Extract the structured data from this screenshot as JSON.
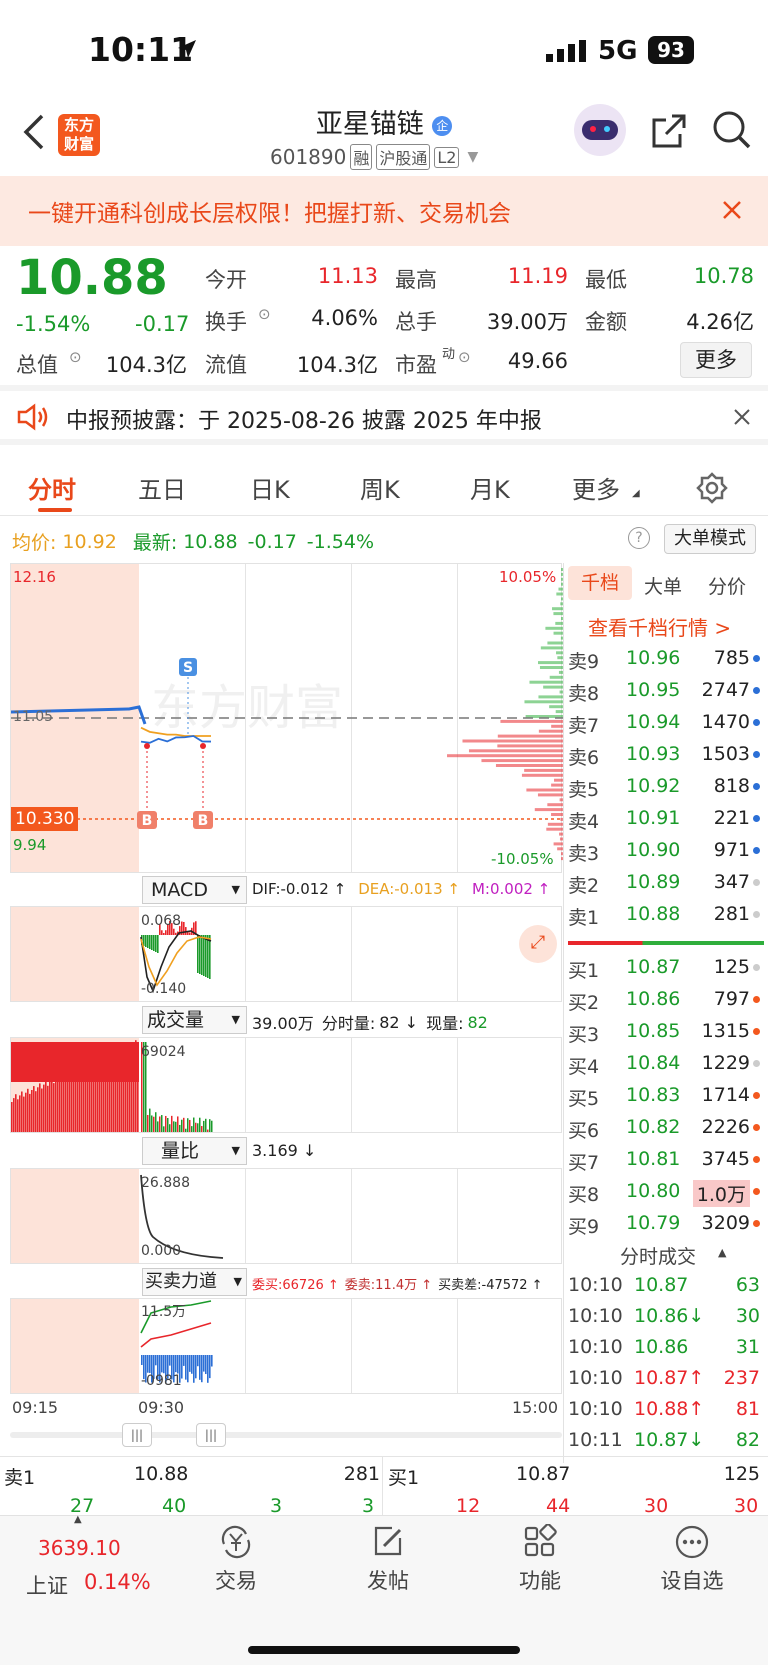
{
  "status_bar": {
    "time": "10:11",
    "network": "5G",
    "battery": "93"
  },
  "header": {
    "back_icon": "chevron-left-icon",
    "logo": "东方\n财富",
    "stock_name": "亚星锚链",
    "qualified_badge": "企",
    "code": "601890",
    "tags": [
      "融",
      "沪股通",
      "L2"
    ],
    "share_icon": "share-icon",
    "search_icon": "search-icon"
  },
  "banner": {
    "text": "一键开通科创成长层权限！把握打新、交易机会"
  },
  "quote": {
    "price": "10.88",
    "change_pct": "-1.54%",
    "change": "-0.17",
    "fields": [
      {
        "label": "今开",
        "value": "11.13",
        "color": "red"
      },
      {
        "label": "最高",
        "value": "11.19",
        "color": "red"
      },
      {
        "label": "最低",
        "value": "10.78",
        "color": "green"
      },
      {
        "label": "换手",
        "value": "4.06%",
        "color": "dark"
      },
      {
        "label": "总手",
        "value": "39.00万",
        "color": "dark"
      },
      {
        "label": "金额",
        "value": "4.26亿",
        "color": "dark"
      },
      {
        "label": "总值",
        "value": "104.3亿",
        "color": "dark"
      },
      {
        "label": "流值",
        "value": "104.3亿",
        "color": "dark"
      },
      {
        "label": "市盈",
        "value": "49.66",
        "color": "dark"
      }
    ],
    "pe_superscript": "动",
    "more_button": "更多"
  },
  "notice": {
    "text": "中报预披露：于 2025-08-26 披露 2025 年中报"
  },
  "tabs": [
    "分时",
    "五日",
    "日K",
    "周K",
    "月K",
    "更多"
  ],
  "tabs_active": "分时",
  "info_line": {
    "avg_label": "均价:",
    "avg": "10.92",
    "latest_label": "最新:",
    "latest": "10.88",
    "change": "-0.17",
    "pct": "-1.54%",
    "bigorder_button": "大单模式"
  },
  "main_chart": {
    "top_price": "12.16",
    "bottom_price": "9.94",
    "top_pct": "10.05%",
    "bottom_pct": "-10.05%",
    "ref_price": "11.05",
    "cursor_price": "10.330",
    "watermark": "东方财富",
    "marker_s": "S",
    "marker_b": "B"
  },
  "chart_data": {
    "type": "line",
    "x": [
      "09:30",
      "09:35",
      "09:40",
      "09:45",
      "09:50",
      "09:55",
      "10:00",
      "10:05",
      "10:11"
    ],
    "series": [
      {
        "name": "价格",
        "values": [
          10.88,
          10.9,
          10.9,
          10.91,
          10.91,
          10.94,
          10.92,
          10.91,
          10.88
        ]
      },
      {
        "name": "均价",
        "values": [
          10.98,
          10.95,
          10.94,
          10.93,
          10.93,
          10.92,
          10.92,
          10.92,
          10.92
        ]
      }
    ],
    "ylim": [
      9.94,
      12.16
    ],
    "pre_close": 11.05
  },
  "macd": {
    "label": "MACD",
    "dif": "DIF:-0.012 ↑",
    "dea": "DEA:-0.013 ↑",
    "m": "M:0.002 ↑",
    "top": "0.068",
    "bottom": "-0.140"
  },
  "volume": {
    "label": "成交量",
    "total": "39.00万",
    "period_label": "分时量:",
    "period": "82 ↓",
    "now_label": "现量:",
    "now": "82",
    "top": "69024"
  },
  "ratio": {
    "label": "量比",
    "value": "3.169 ↓",
    "top": "26.888",
    "bottom": "0.000"
  },
  "force": {
    "label": "买卖力道",
    "buy": "委买:66726 ↑",
    "sell": "委卖:11.4万 ↑",
    "diff": "买卖差:-47572 ↑",
    "top": "11.5万",
    "bottom": "-0981"
  },
  "time_axis": [
    "09:15",
    "09:30",
    "15:00"
  ],
  "right_tabs": [
    "千档",
    "大单",
    "分价"
  ],
  "right_link": "查看千档行情 >",
  "asks": [
    {
      "label": "卖9",
      "price": "10.96",
      "vol": "785"
    },
    {
      "label": "卖8",
      "price": "10.95",
      "vol": "2747"
    },
    {
      "label": "卖7",
      "price": "10.94",
      "vol": "1470"
    },
    {
      "label": "卖6",
      "price": "10.93",
      "vol": "1503"
    },
    {
      "label": "卖5",
      "price": "10.92",
      "vol": "818"
    },
    {
      "label": "卖4",
      "price": "10.91",
      "vol": "221"
    },
    {
      "label": "卖3",
      "price": "10.90",
      "vol": "971"
    },
    {
      "label": "卖2",
      "price": "10.89",
      "vol": "347"
    },
    {
      "label": "卖1",
      "price": "10.88",
      "vol": "281"
    }
  ],
  "bids": [
    {
      "label": "买1",
      "price": "10.87",
      "vol": "125"
    },
    {
      "label": "买2",
      "price": "10.86",
      "vol": "797"
    },
    {
      "label": "买3",
      "price": "10.85",
      "vol": "1315"
    },
    {
      "label": "买4",
      "price": "10.84",
      "vol": "1229"
    },
    {
      "label": "买5",
      "price": "10.83",
      "vol": "1714"
    },
    {
      "label": "买6",
      "price": "10.82",
      "vol": "2226"
    },
    {
      "label": "买7",
      "price": "10.81",
      "vol": "3745"
    },
    {
      "label": "买8",
      "price": "10.80",
      "vol": "1.0万"
    },
    {
      "label": "买9",
      "price": "10.79",
      "vol": "3209"
    }
  ],
  "trades_title": "分时成交",
  "trades": [
    {
      "time": "10:10",
      "price": "10.87",
      "vol": "63",
      "color": "green"
    },
    {
      "time": "10:10",
      "price": "10.86↓",
      "vol": "30",
      "color": "green"
    },
    {
      "time": "10:10",
      "price": "10.86",
      "vol": "31",
      "color": "green"
    },
    {
      "time": "10:10",
      "price": "10.87↑",
      "vol": "237",
      "color": "red"
    },
    {
      "time": "10:10",
      "price": "10.88↑",
      "vol": "81",
      "color": "red"
    },
    {
      "time": "10:11",
      "price": "10.87↓",
      "vol": "82",
      "color": "green"
    }
  ],
  "bottom_strip": {
    "sell_label": "卖1",
    "sell_price": "10.88",
    "sell_vol": "281",
    "buy_label": "买1",
    "buy_price": "10.87",
    "buy_vol": "125",
    "left_nums": [
      "27",
      "40",
      "3",
      "3"
    ],
    "right_nums": [
      "12",
      "44",
      "30",
      "30"
    ]
  },
  "index": {
    "value": "3639.10",
    "name": "上证",
    "pct": "0.14%"
  },
  "nav": [
    {
      "label": "交易",
      "icon": "yen-cycle-icon"
    },
    {
      "label": "发帖",
      "icon": "edit-icon"
    },
    {
      "label": "功能",
      "icon": "grid-icon"
    },
    {
      "label": "设自选",
      "icon": "more-dots-icon"
    }
  ]
}
